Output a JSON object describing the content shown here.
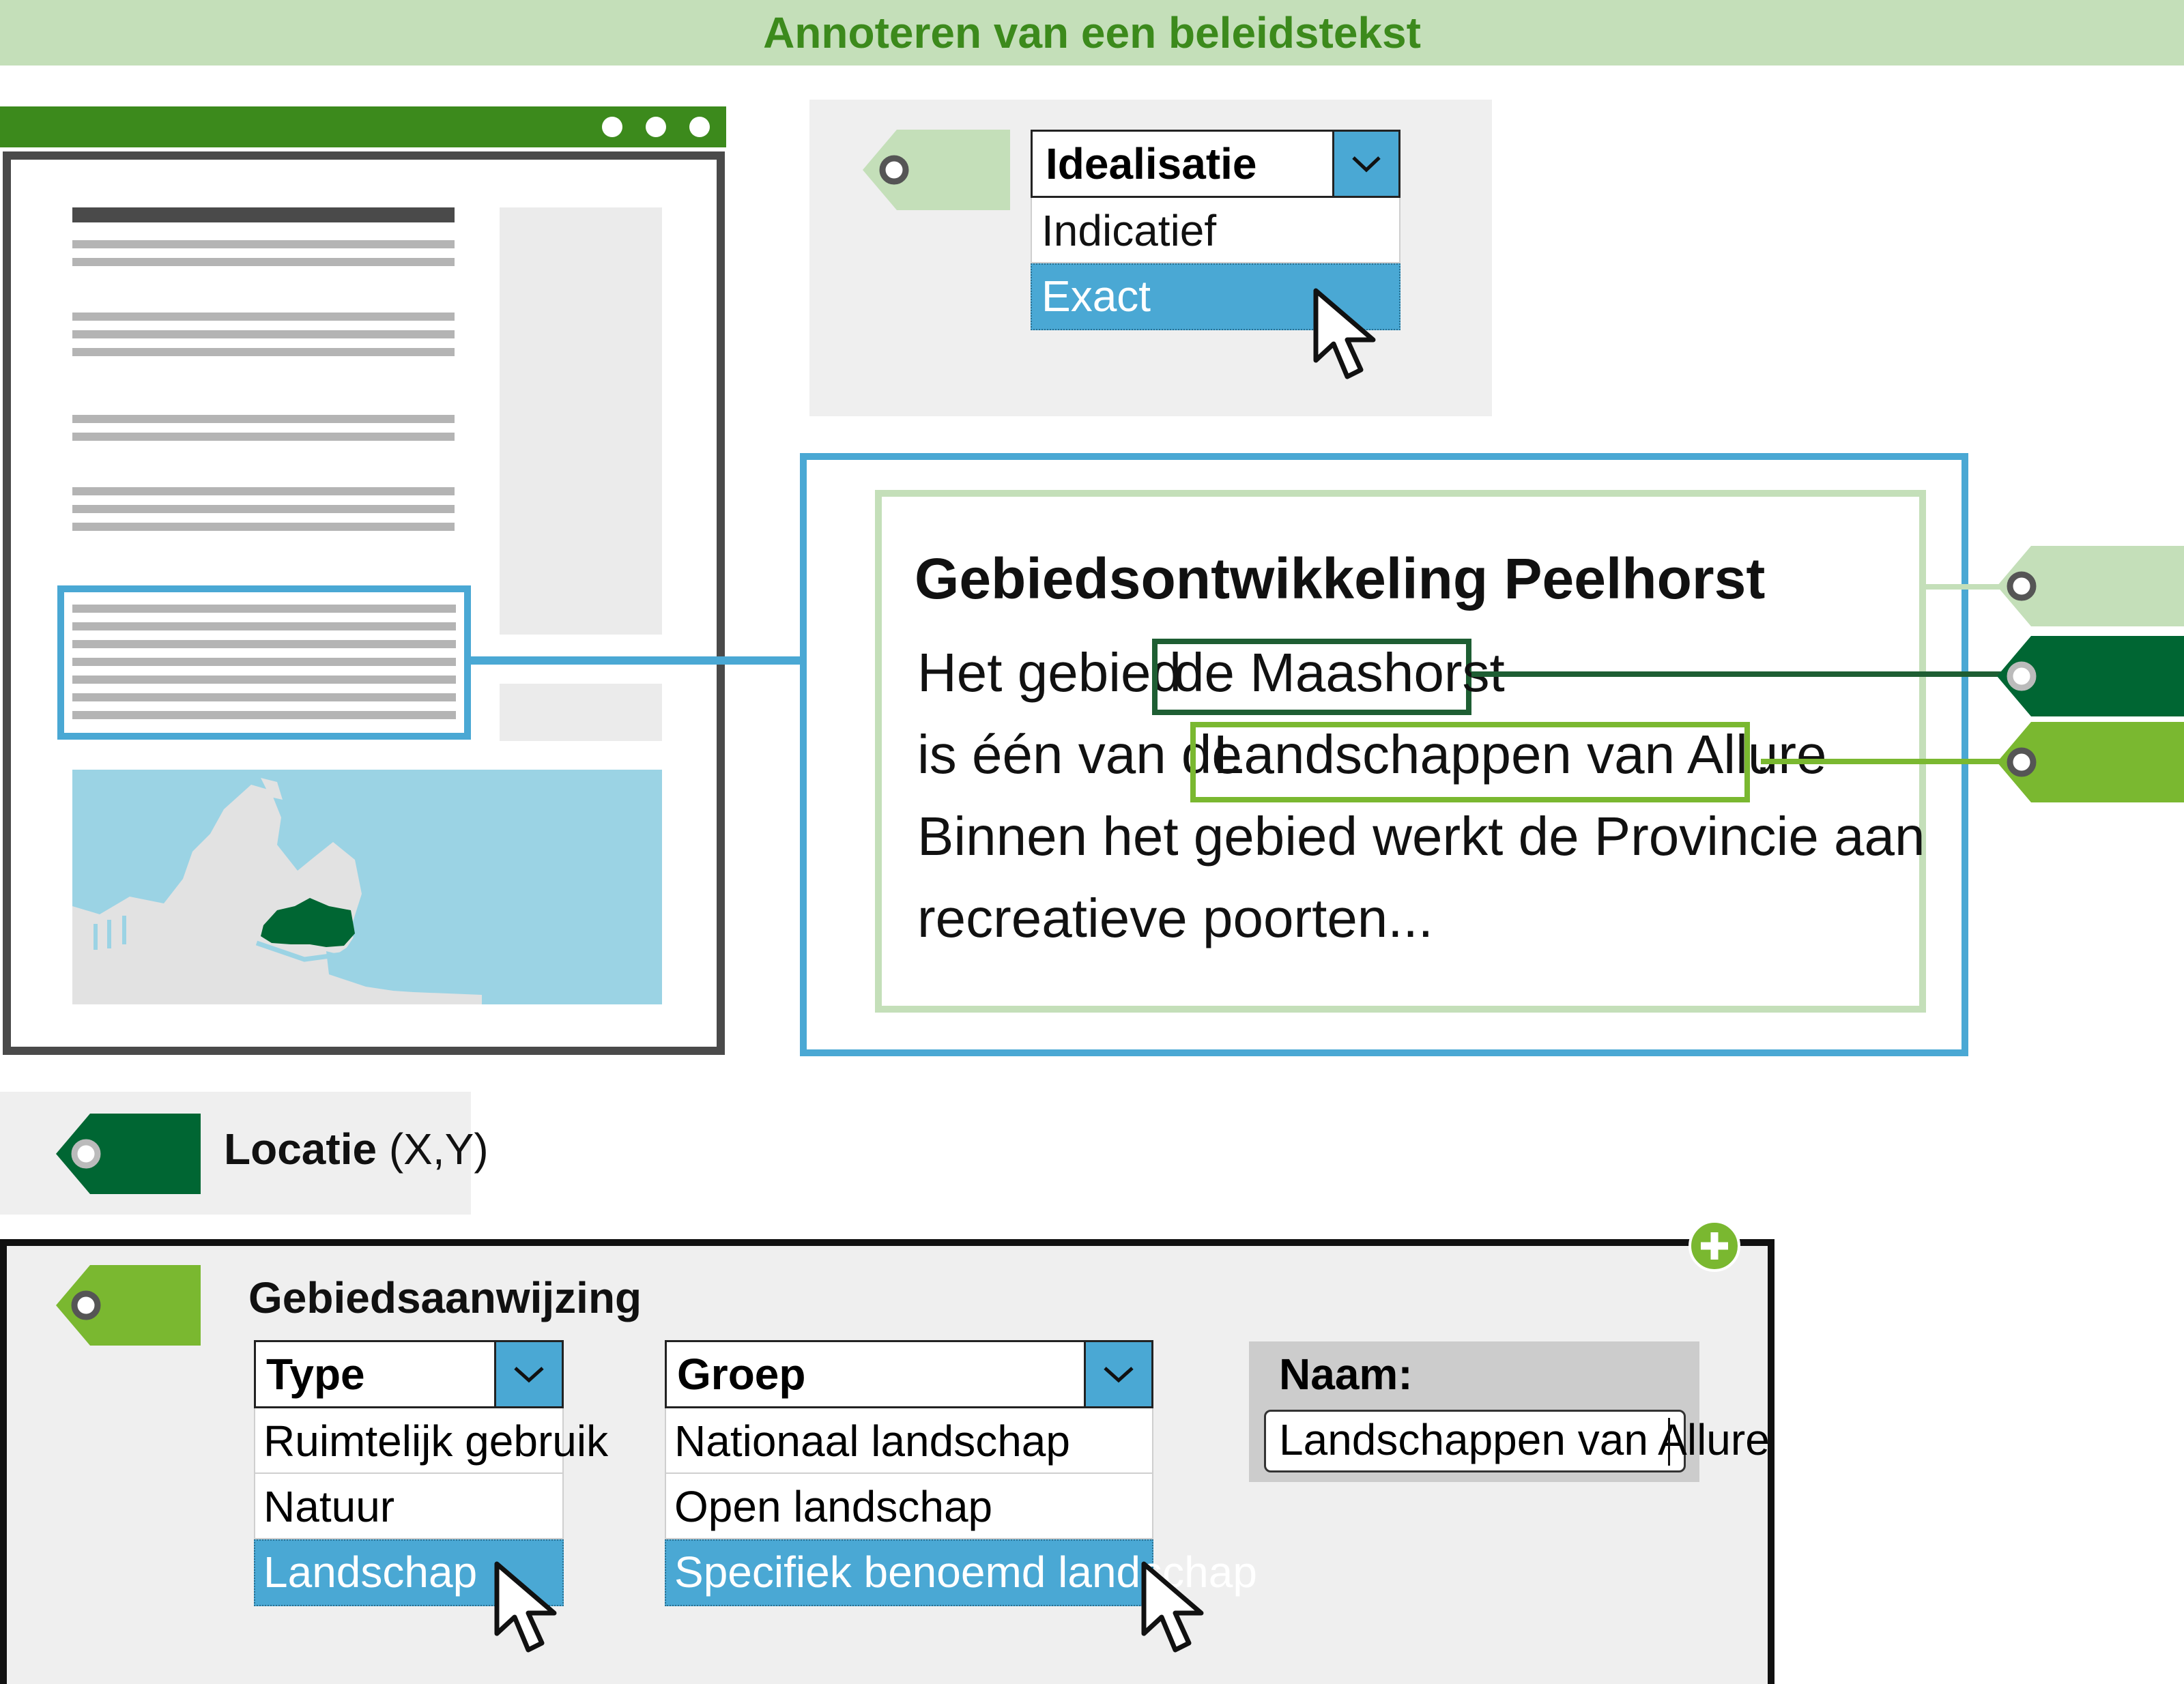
{
  "title": "Annoteren van een beleidstekst",
  "idealisatie": {
    "header": "Idealisatie",
    "options": [
      "Indicatief",
      "Exact"
    ],
    "selected": "Exact"
  },
  "text_panel": {
    "heading": "Gebiedsontwikkeling Peelhorst",
    "line1_prefix": "Het gebied",
    "highlight_location": "de Maashorst",
    "line2_prefix": "is één van de",
    "highlight_area": "Landschappen van Allure",
    "line2_suffix": ".",
    "line3": "Binnen het gebied werkt de Provincie aan",
    "line4": "recreatieve poorten..."
  },
  "locatie": {
    "label": "Locatie",
    "coords": "(X,Y)"
  },
  "gebiedsaanwijzing": {
    "label": "Gebiedsaanwijzing",
    "type_dropdown": {
      "header": "Type",
      "options": [
        "Ruimtelijk gebruik",
        "Natuur",
        "Landschap"
      ],
      "selected": "Landschap"
    },
    "groep_dropdown": {
      "header": "Groep",
      "options": [
        "Nationaal landschap",
        "Open landschap",
        "Specifiek benoemd landschap"
      ],
      "selected": "Specifiek benoemd landschap"
    },
    "naam": {
      "label": "Naam:",
      "value": "Landschappen van Allure"
    }
  },
  "colors": {
    "light_green": "#c4dfb9",
    "title_green": "#3c8a1c",
    "dark_green": "#006633",
    "medium_green": "#7ab830",
    "blue": "#4aa8d4",
    "panel_gray": "#efefef",
    "map_water": "#9bd3e4",
    "map_land": "#e2e2e2"
  },
  "icons": {
    "tag": "tag-icon",
    "cursor": "cursor-arrow-icon",
    "dropdown": "chevron-down-icon",
    "add": "plus-circle-icon"
  }
}
